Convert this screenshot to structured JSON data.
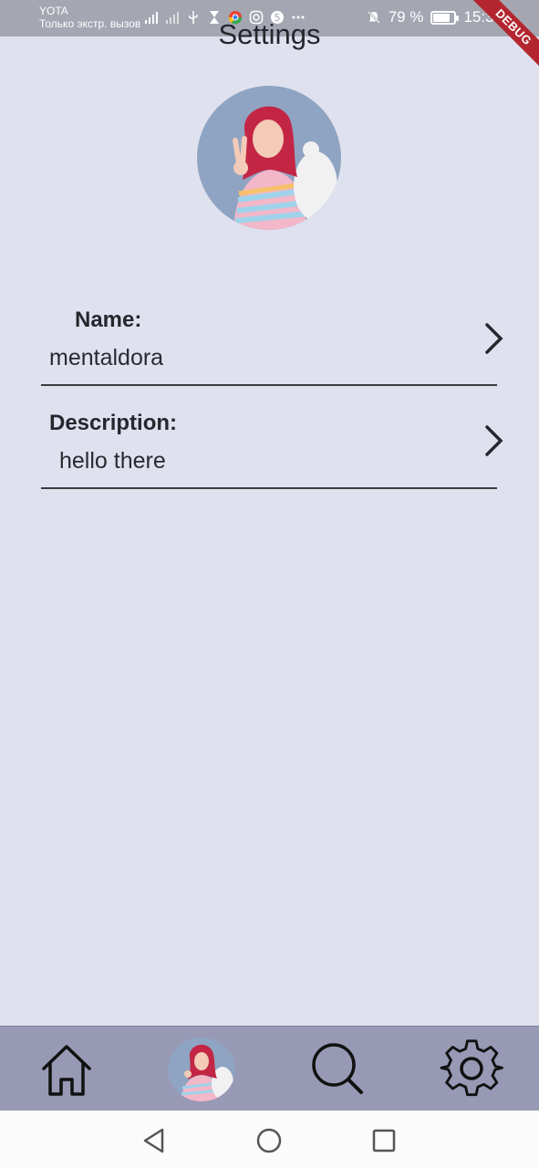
{
  "status_bar": {
    "carrier": "YOTA",
    "carrier_sub": "Только экстр. вызов",
    "battery_percent": "79 %",
    "battery_level": 0.79,
    "time": "15:39",
    "icons": [
      "network-4g-icon",
      "signal-icon",
      "no-signal-icon",
      "usb-icon",
      "hourglass-icon",
      "chrome-icon",
      "instagram-icon",
      "number-5-icon",
      "more-icon",
      "mute-bell-icon",
      "battery-icon"
    ]
  },
  "debug_banner": "DEBUG",
  "page": {
    "title": "Settings"
  },
  "profile": {
    "avatar_icon": "profile-photo"
  },
  "fields": [
    {
      "label": "Name:",
      "value": "mentaldora",
      "icon": "chevron-right-icon"
    },
    {
      "label": "Description:",
      "value": "hello there",
      "icon": "chevron-right-icon"
    }
  ],
  "bottom_nav": {
    "items": [
      "home-icon",
      "profile-avatar",
      "search-icon",
      "gear-icon"
    ]
  },
  "system_nav": {
    "items": [
      "back-icon",
      "home-circle-icon",
      "recents-icon"
    ]
  },
  "colors": {
    "background": "#dfe1ee",
    "status_bar": "#a4a6b1",
    "bottom_nav": "#9899b4",
    "debug": "#b3262f"
  }
}
